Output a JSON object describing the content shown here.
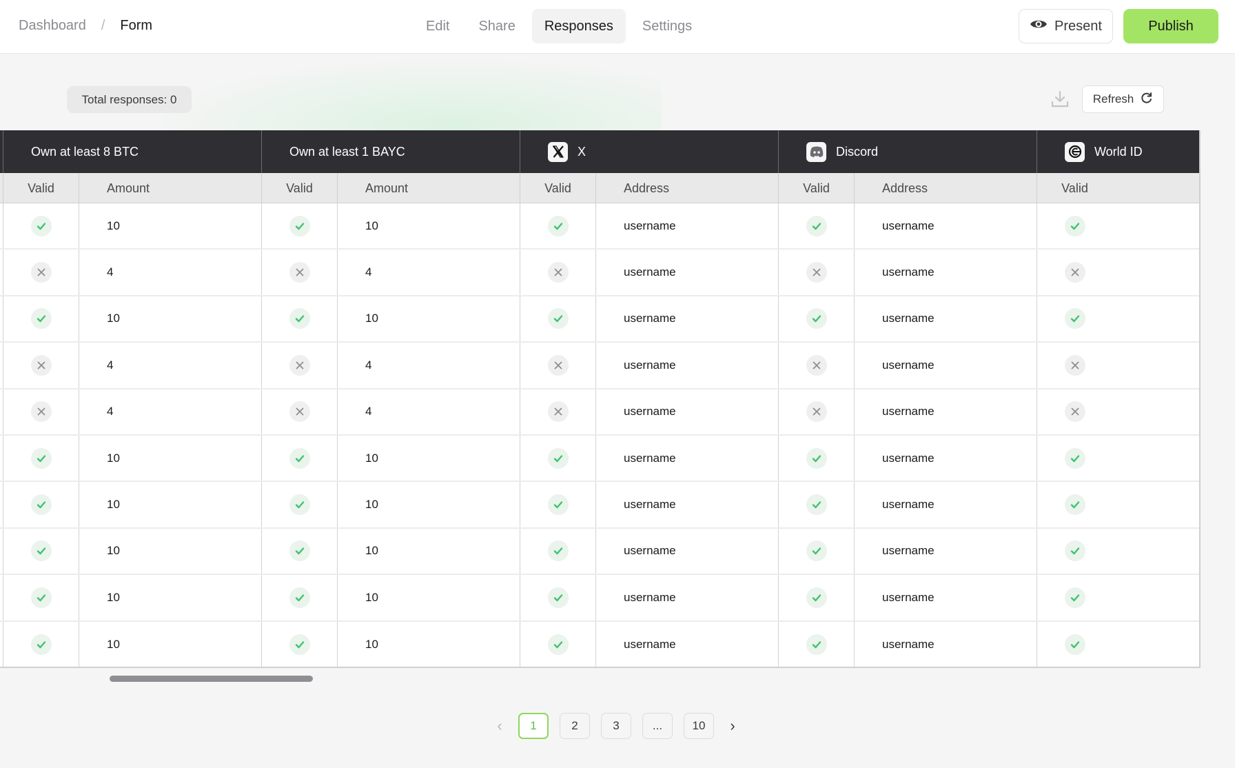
{
  "header": {
    "breadcrumb": [
      {
        "label": "Dashboard"
      },
      {
        "label": "Form"
      }
    ],
    "breadcrumb_separator": "/",
    "tabs": [
      {
        "label": "Edit",
        "active": false
      },
      {
        "label": "Share",
        "active": false
      },
      {
        "label": "Responses",
        "active": true
      },
      {
        "label": "Settings",
        "active": false
      }
    ],
    "present_label": "Present",
    "present_icon": "eye-icon",
    "publish_label": "Publish"
  },
  "toolbar": {
    "total_responses_label": "Total responses: 0",
    "download_icon": "download-icon",
    "refresh_label": "Refresh",
    "refresh_icon": "refresh-icon"
  },
  "colors": {
    "accent": "#a4e465",
    "header_dark": "#2f2e33",
    "valid_green": "#3ec46d",
    "invalid_gray": "#8e8e93"
  },
  "table": {
    "groups": [
      {
        "title": "Own at least 8 BTC",
        "icon": null,
        "subcolumns": [
          "Valid",
          "Amount"
        ]
      },
      {
        "title": "Own at least 1 BAYC",
        "icon": null,
        "subcolumns": [
          "Valid",
          "Amount"
        ]
      },
      {
        "title": "X",
        "icon": "x-logo-icon",
        "subcolumns": [
          "Valid",
          "Address"
        ]
      },
      {
        "title": "Discord",
        "icon": "discord-logo-icon",
        "subcolumns": [
          "Valid",
          "Address"
        ]
      },
      {
        "title": "World ID",
        "icon": "worldid-logo-icon",
        "subcolumns": [
          "Valid"
        ]
      }
    ],
    "rows": [
      {
        "btc_valid": true,
        "btc_amount": "10",
        "bayc_valid": true,
        "bayc_amount": "10",
        "x_valid": true,
        "x_address": "username",
        "discord_valid": true,
        "discord_address": "username",
        "worldid_valid": true
      },
      {
        "btc_valid": false,
        "btc_amount": "4",
        "bayc_valid": false,
        "bayc_amount": "4",
        "x_valid": false,
        "x_address": "username",
        "discord_valid": false,
        "discord_address": "username",
        "worldid_valid": false
      },
      {
        "btc_valid": true,
        "btc_amount": "10",
        "bayc_valid": true,
        "bayc_amount": "10",
        "x_valid": true,
        "x_address": "username",
        "discord_valid": true,
        "discord_address": "username",
        "worldid_valid": true
      },
      {
        "btc_valid": false,
        "btc_amount": "4",
        "bayc_valid": false,
        "bayc_amount": "4",
        "x_valid": false,
        "x_address": "username",
        "discord_valid": false,
        "discord_address": "username",
        "worldid_valid": false
      },
      {
        "btc_valid": false,
        "btc_amount": "4",
        "bayc_valid": false,
        "bayc_amount": "4",
        "x_valid": false,
        "x_address": "username",
        "discord_valid": false,
        "discord_address": "username",
        "worldid_valid": false
      },
      {
        "btc_valid": true,
        "btc_amount": "10",
        "bayc_valid": true,
        "bayc_amount": "10",
        "x_valid": true,
        "x_address": "username",
        "discord_valid": true,
        "discord_address": "username",
        "worldid_valid": true
      },
      {
        "btc_valid": true,
        "btc_amount": "10",
        "bayc_valid": true,
        "bayc_amount": "10",
        "x_valid": true,
        "x_address": "username",
        "discord_valid": true,
        "discord_address": "username",
        "worldid_valid": true
      },
      {
        "btc_valid": true,
        "btc_amount": "10",
        "bayc_valid": true,
        "bayc_amount": "10",
        "x_valid": true,
        "x_address": "username",
        "discord_valid": true,
        "discord_address": "username",
        "worldid_valid": true
      },
      {
        "btc_valid": true,
        "btc_amount": "10",
        "bayc_valid": true,
        "bayc_amount": "10",
        "x_valid": true,
        "x_address": "username",
        "discord_valid": true,
        "discord_address": "username",
        "worldid_valid": true
      },
      {
        "btc_valid": true,
        "btc_amount": "10",
        "bayc_valid": true,
        "bayc_amount": "10",
        "x_valid": true,
        "x_address": "username",
        "discord_valid": true,
        "discord_address": "username",
        "worldid_valid": true
      }
    ]
  },
  "pagination": {
    "prev_icon": "chevron-left-icon",
    "next_icon": "chevron-right-icon",
    "pages": [
      {
        "label": "1",
        "active": true
      },
      {
        "label": "2",
        "active": false
      },
      {
        "label": "3",
        "active": false
      },
      {
        "label": "...",
        "active": false
      },
      {
        "label": "10",
        "active": false
      }
    ]
  }
}
